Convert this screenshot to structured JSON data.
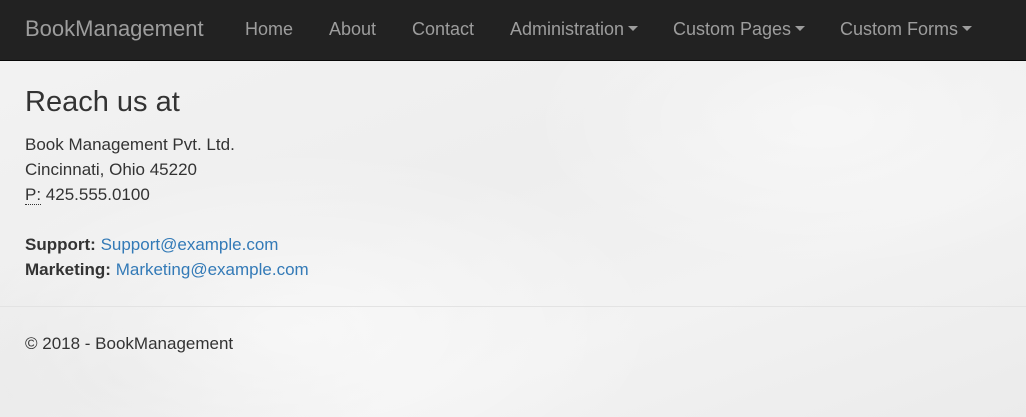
{
  "navbar": {
    "brand": "BookManagement",
    "items": [
      {
        "label": "Home",
        "has_dropdown": false
      },
      {
        "label": "About",
        "has_dropdown": false
      },
      {
        "label": "Contact",
        "has_dropdown": false
      },
      {
        "label": "Administration",
        "has_dropdown": true
      },
      {
        "label": "Custom Pages",
        "has_dropdown": true
      },
      {
        "label": "Custom Forms",
        "has_dropdown": true
      }
    ]
  },
  "main": {
    "heading": "Reach us at",
    "address": {
      "company": "Book Management Pvt. Ltd.",
      "city_line": "Cincinnati, Ohio 45220",
      "phone_label": "P:",
      "phone": "425.555.0100"
    },
    "contacts": {
      "support_label": "Support:",
      "support_email": "Support@example.com",
      "marketing_label": "Marketing:",
      "marketing_email": "Marketing@example.com"
    }
  },
  "footer": {
    "text": "© 2018 - BookManagement"
  },
  "colors": {
    "navbar_bg": "#222222",
    "nav_text": "#9d9d9d",
    "link": "#337ab7",
    "body_text": "#333333"
  }
}
